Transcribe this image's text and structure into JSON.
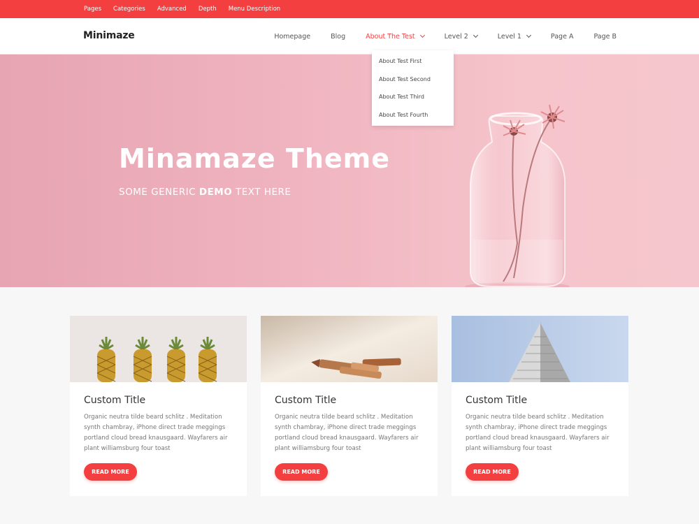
{
  "topbar": {
    "links": [
      "Pages",
      "Categories",
      "Advanced",
      "Depth",
      "Menu Description"
    ]
  },
  "header": {
    "logo": "Minimaze",
    "nav": {
      "homepage": "Homepage",
      "blog": "Blog",
      "about": "About The Test",
      "level2": "Level 2",
      "level1": "Level 1",
      "pageA": "Page A",
      "pageB": "Page B"
    }
  },
  "dropdown": {
    "items": [
      "About Test First",
      "About Test Second",
      "About Test Third",
      "About Test Fourth"
    ]
  },
  "hero": {
    "title": "Minamaze  Theme",
    "subtitle_pre": "SOME GENERIC ",
    "subtitle_bold": "DEMO",
    "subtitle_post": " TEXT HERE"
  },
  "cards": [
    {
      "title": "Custom Title",
      "text": "Organic neutra tilde beard schlitz . Meditation synth chambray, iPhone direct trade meggings portland cloud bread knausgaard. Wayfarers air plant williamsburg four toast",
      "button": "READ MORE",
      "image": "pineapples"
    },
    {
      "title": "Custom Title",
      "text": "Organic neutra tilde beard schlitz . Meditation synth chambray, iPhone direct trade meggings portland cloud bread knausgaard. Wayfarers air plant williamsburg four toast",
      "button": "READ MORE",
      "image": "pencils"
    },
    {
      "title": "Custom Title",
      "text": "Organic neutra tilde beard schlitz . Meditation synth chambray, iPhone direct trade meggings portland cloud bread knausgaard. Wayfarers air plant williamsburg four toast",
      "button": "READ MORE",
      "image": "building"
    }
  ],
  "colors": {
    "accent": "#f43f40",
    "hero_pink": "#f0b5c0"
  }
}
